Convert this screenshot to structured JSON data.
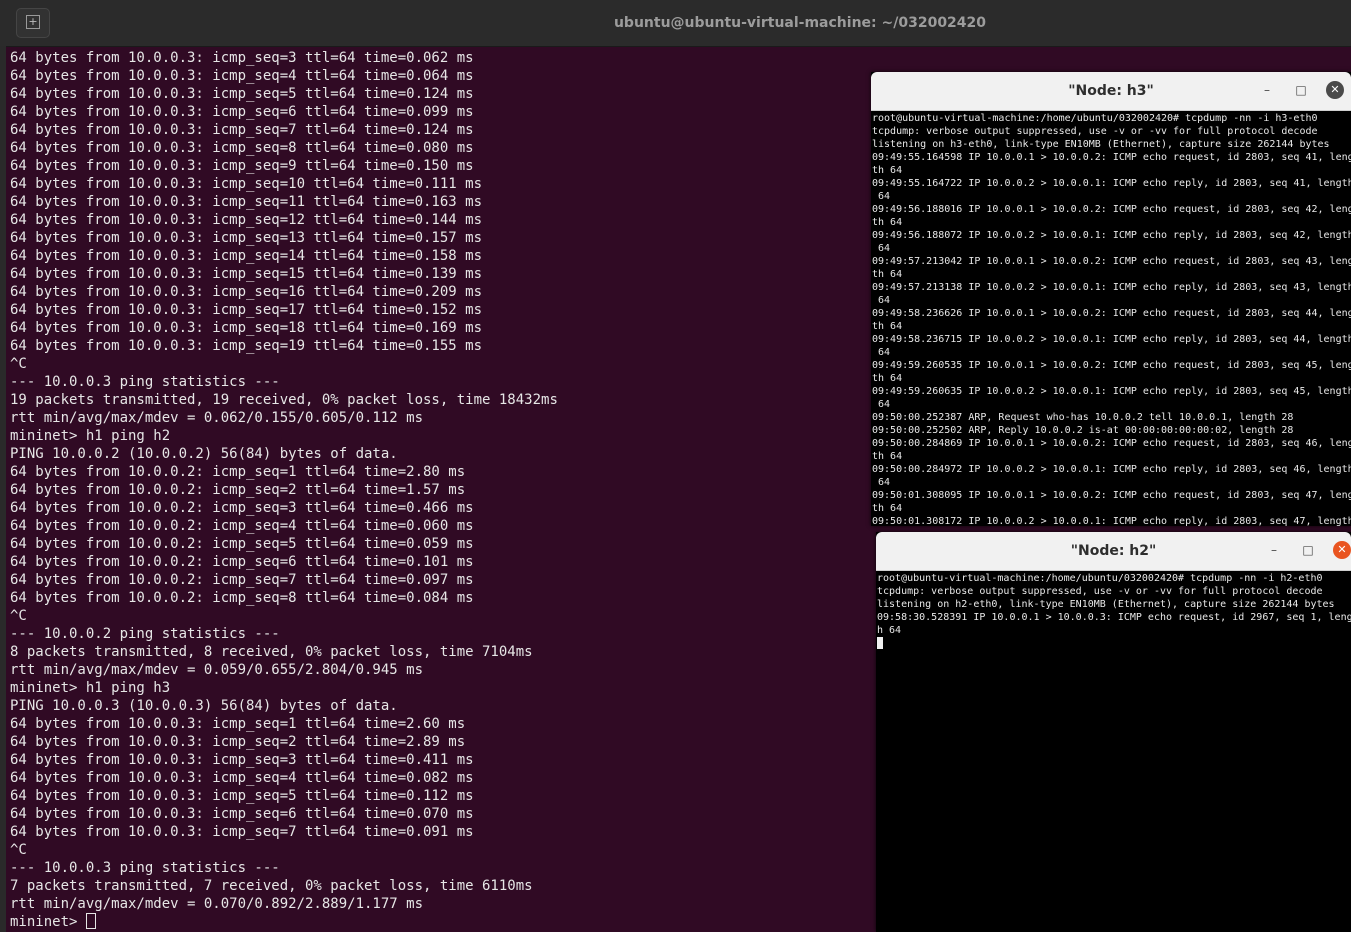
{
  "main_window": {
    "title": "ubuntu@ubuntu-virtual-machine: ~/032002420",
    "new_tab_icon": "new-tab-icon",
    "lines": [
      "64 bytes from 10.0.0.3: icmp_seq=3 ttl=64 time=0.062 ms",
      "64 bytes from 10.0.0.3: icmp_seq=4 ttl=64 time=0.064 ms",
      "64 bytes from 10.0.0.3: icmp_seq=5 ttl=64 time=0.124 ms",
      "64 bytes from 10.0.0.3: icmp_seq=6 ttl=64 time=0.099 ms",
      "64 bytes from 10.0.0.3: icmp_seq=7 ttl=64 time=0.124 ms",
      "64 bytes from 10.0.0.3: icmp_seq=8 ttl=64 time=0.080 ms",
      "64 bytes from 10.0.0.3: icmp_seq=9 ttl=64 time=0.150 ms",
      "64 bytes from 10.0.0.3: icmp_seq=10 ttl=64 time=0.111 ms",
      "64 bytes from 10.0.0.3: icmp_seq=11 ttl=64 time=0.163 ms",
      "64 bytes from 10.0.0.3: icmp_seq=12 ttl=64 time=0.144 ms",
      "64 bytes from 10.0.0.3: icmp_seq=13 ttl=64 time=0.157 ms",
      "64 bytes from 10.0.0.3: icmp_seq=14 ttl=64 time=0.158 ms",
      "64 bytes from 10.0.0.3: icmp_seq=15 ttl=64 time=0.139 ms",
      "64 bytes from 10.0.0.3: icmp_seq=16 ttl=64 time=0.209 ms",
      "64 bytes from 10.0.0.3: icmp_seq=17 ttl=64 time=0.152 ms",
      "64 bytes from 10.0.0.3: icmp_seq=18 ttl=64 time=0.169 ms",
      "64 bytes from 10.0.0.3: icmp_seq=19 ttl=64 time=0.155 ms",
      "^C",
      "--- 10.0.0.3 ping statistics ---",
      "19 packets transmitted, 19 received, 0% packet loss, time 18432ms",
      "rtt min/avg/max/mdev = 0.062/0.155/0.605/0.112 ms",
      "mininet> h1 ping h2",
      "PING 10.0.0.2 (10.0.0.2) 56(84) bytes of data.",
      "64 bytes from 10.0.0.2: icmp_seq=1 ttl=64 time=2.80 ms",
      "64 bytes from 10.0.0.2: icmp_seq=2 ttl=64 time=1.57 ms",
      "64 bytes from 10.0.0.2: icmp_seq=3 ttl=64 time=0.466 ms",
      "64 bytes from 10.0.0.2: icmp_seq=4 ttl=64 time=0.060 ms",
      "64 bytes from 10.0.0.2: icmp_seq=5 ttl=64 time=0.059 ms",
      "64 bytes from 10.0.0.2: icmp_seq=6 ttl=64 time=0.101 ms",
      "64 bytes from 10.0.0.2: icmp_seq=7 ttl=64 time=0.097 ms",
      "64 bytes from 10.0.0.2: icmp_seq=8 ttl=64 time=0.084 ms",
      "^C",
      "--- 10.0.0.2 ping statistics ---",
      "8 packets transmitted, 8 received, 0% packet loss, time 7104ms",
      "rtt min/avg/max/mdev = 0.059/0.655/2.804/0.945 ms",
      "mininet> h1 ping h3",
      "PING 10.0.0.3 (10.0.0.3) 56(84) bytes of data.",
      "64 bytes from 10.0.0.3: icmp_seq=1 ttl=64 time=2.60 ms",
      "64 bytes from 10.0.0.3: icmp_seq=2 ttl=64 time=2.89 ms",
      "64 bytes from 10.0.0.3: icmp_seq=3 ttl=64 time=0.411 ms",
      "64 bytes from 10.0.0.3: icmp_seq=4 ttl=64 time=0.082 ms",
      "64 bytes from 10.0.0.3: icmp_seq=5 ttl=64 time=0.112 ms",
      "64 bytes from 10.0.0.3: icmp_seq=6 ttl=64 time=0.070 ms",
      "64 bytes from 10.0.0.3: icmp_seq=7 ttl=64 time=0.091 ms",
      "^C",
      "--- 10.0.0.3 ping statistics ---",
      "7 packets transmitted, 7 received, 0% packet loss, time 6110ms",
      "rtt min/avg/max/mdev = 0.070/0.892/2.889/1.177 ms"
    ],
    "prompt": "mininet> "
  },
  "node_h3": {
    "title": "\"Node: h3\"",
    "minimize_glyph": "–",
    "maximize_glyph": "□",
    "close_glyph": "✕",
    "lines": [
      "root@ubuntu-virtual-machine:/home/ubuntu/032002420# tcpdump -nn -i h3-eth0",
      "tcpdump: verbose output suppressed, use -v or -vv for full protocol decode",
      "listening on h3-eth0, link-type EN10MB (Ethernet), capture size 262144 bytes",
      "09:49:55.164598 IP 10.0.0.1 > 10.0.0.2: ICMP echo request, id 2803, seq 41, leng",
      "th 64",
      "09:49:55.164722 IP 10.0.0.2 > 10.0.0.1: ICMP echo reply, id 2803, seq 41, length",
      " 64",
      "09:49:56.188016 IP 10.0.0.1 > 10.0.0.2: ICMP echo request, id 2803, seq 42, leng",
      "th 64",
      "09:49:56.188072 IP 10.0.0.2 > 10.0.0.1: ICMP echo reply, id 2803, seq 42, length",
      " 64",
      "09:49:57.213042 IP 10.0.0.1 > 10.0.0.2: ICMP echo request, id 2803, seq 43, leng",
      "th 64",
      "09:49:57.213138 IP 10.0.0.2 > 10.0.0.1: ICMP echo reply, id 2803, seq 43, length",
      " 64",
      "09:49:58.236626 IP 10.0.0.1 > 10.0.0.2: ICMP echo request, id 2803, seq 44, leng",
      "th 64",
      "09:49:58.236715 IP 10.0.0.2 > 10.0.0.1: ICMP echo reply, id 2803, seq 44, length",
      " 64",
      "09:49:59.260535 IP 10.0.0.1 > 10.0.0.2: ICMP echo request, id 2803, seq 45, leng",
      "th 64",
      "09:49:59.260635 IP 10.0.0.2 > 10.0.0.1: ICMP echo reply, id 2803, seq 45, length",
      " 64",
      "09:50:00.252387 ARP, Request who-has 10.0.0.2 tell 10.0.0.1, length 28",
      "09:50:00.252502 ARP, Reply 10.0.0.2 is-at 00:00:00:00:00:02, length 28",
      "09:50:00.284869 IP 10.0.0.1 > 10.0.0.2: ICMP echo request, id 2803, seq 46, leng",
      "th 64",
      "09:50:00.284972 IP 10.0.0.2 > 10.0.0.1: ICMP echo reply, id 2803, seq 46, length",
      " 64",
      "09:50:01.308095 IP 10.0.0.1 > 10.0.0.2: ICMP echo request, id 2803, seq 47, leng",
      "th 64",
      "09:50:01.308172 IP 10.0.0.2 > 10.0.0.1: ICMP echo reply, id 2803, seq 47, length"
    ]
  },
  "node_h2": {
    "title": "\"Node: h2\"",
    "minimize_glyph": "–",
    "maximize_glyph": "□",
    "close_glyph": "✕",
    "lines": [
      "root@ubuntu-virtual-machine:/home/ubuntu/032002420# tcpdump -nn -i h2-eth0",
      "tcpdump: verbose output suppressed, use -v or -vv for full protocol decode",
      "listening on h2-eth0, link-type EN10MB (Ethernet), capture size 262144 bytes",
      "09:58:30.528391 IP 10.0.0.1 > 10.0.0.3: ICMP echo request, id 2967, seq 1, lengt",
      "h 64"
    ]
  },
  "colors": {
    "main_bg": "#300a24",
    "titlebar_bg": "#2b2b2b",
    "node_bg": "#000000",
    "node_titlebar_bg": "#f1f1f1",
    "h3_close_bg": "#4a4a4a",
    "h2_close_bg": "#e95420"
  }
}
